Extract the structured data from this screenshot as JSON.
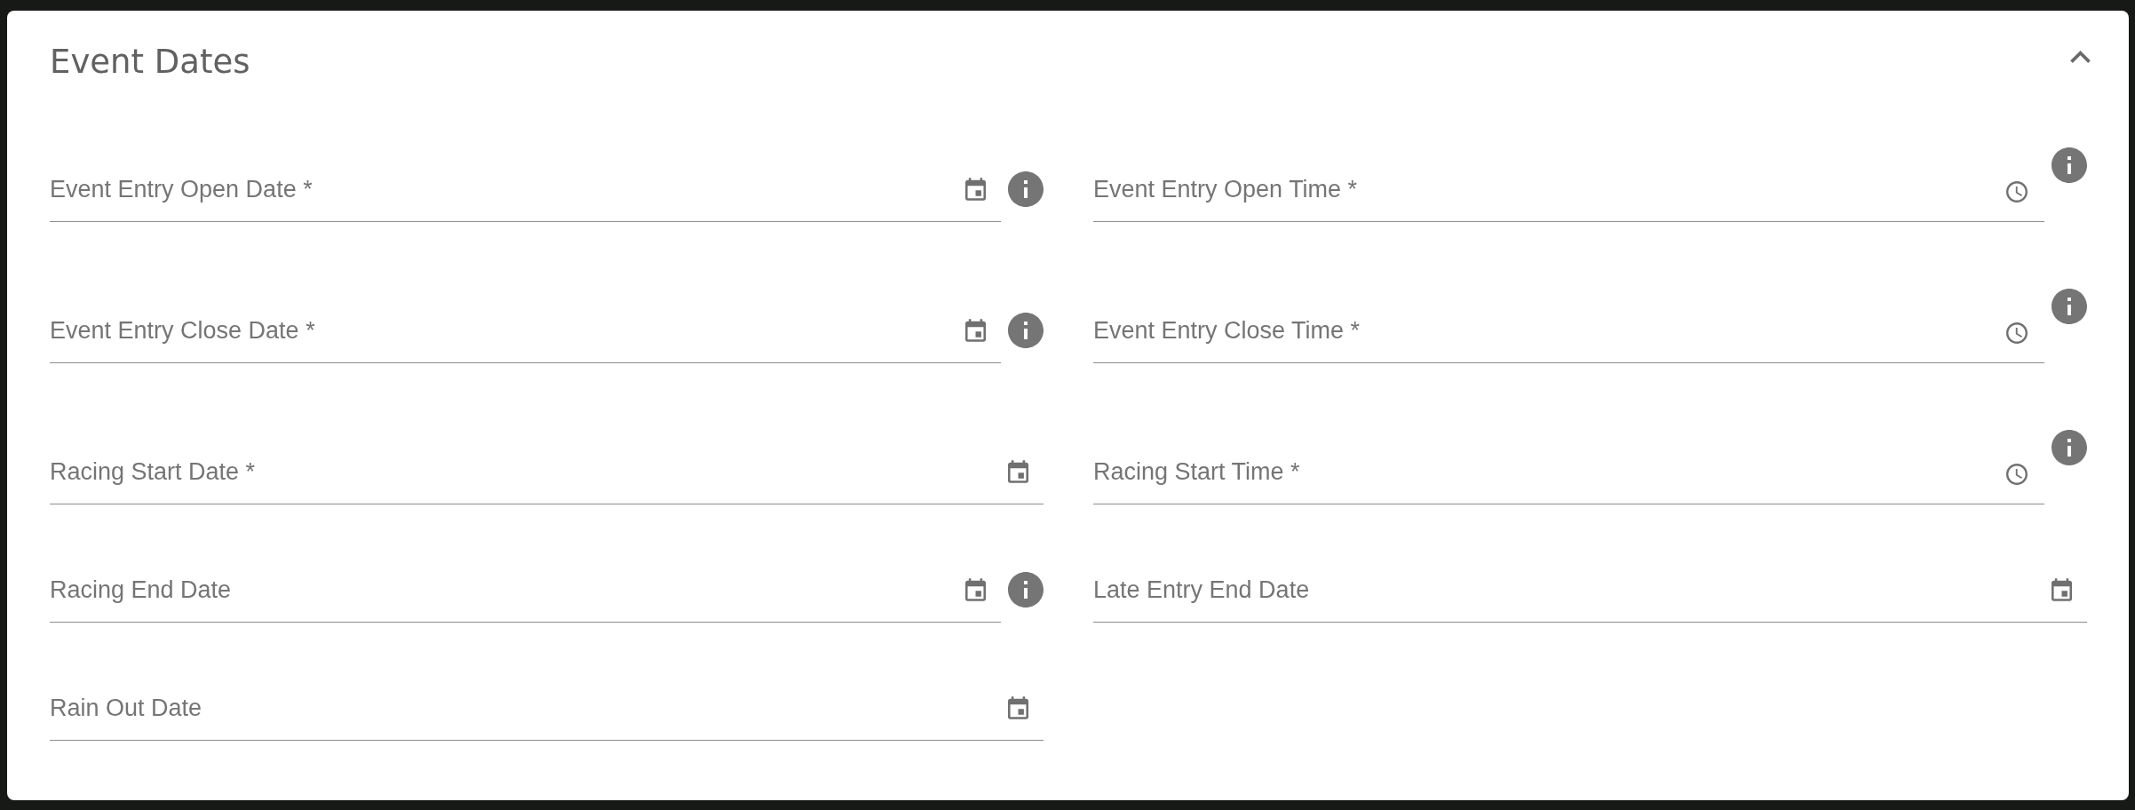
{
  "panel": {
    "title": "Event Dates",
    "expanded": true
  },
  "fields": [
    {
      "label": "Event Entry Open Date *",
      "kind": "date",
      "info": true
    },
    {
      "label": "Event Entry Open Time *",
      "kind": "time",
      "info": true
    },
    {
      "label": "Event Entry Close Date *",
      "kind": "date",
      "info": true
    },
    {
      "label": "Event Entry Close Time *",
      "kind": "time",
      "info": true
    },
    {
      "label": "Racing Start Date *",
      "kind": "date",
      "info": false
    },
    {
      "label": "Racing Start Time *",
      "kind": "time",
      "info": true
    },
    {
      "label": "Racing End Date",
      "kind": "date",
      "info": true
    },
    {
      "label": "Late Entry End Date",
      "kind": "date",
      "info": false
    },
    {
      "label": "Rain Out Date",
      "kind": "date",
      "info": false
    }
  ]
}
